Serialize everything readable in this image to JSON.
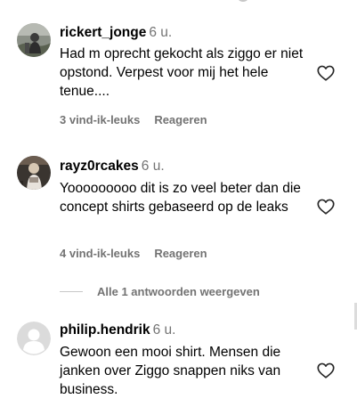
{
  "comments": [
    {
      "username": "rickert_jonge",
      "time": "6 u.",
      "text": "Had m oprecht gekocht als ziggo er niet opstond. Verpest voor mij het hele tenue....",
      "likes": "3 vind-ik-leuks",
      "reply_label": "Reageren",
      "like_icon": "heart-outline-icon"
    },
    {
      "username": "rayz0rcakes",
      "time": "6 u.",
      "text": "Yooooooooo dit is zo veel beter dan die concept shirts gebaseerd op de leaks",
      "likes": "4 vind-ik-leuks",
      "reply_label": "Reageren",
      "like_icon": "heart-outline-icon"
    },
    {
      "username": "philip.hendrik",
      "time": "6 u.",
      "text": "Gewoon een mooi shirt. Mensen die janken over Ziggo snappen niks van business.",
      "like_icon": "heart-outline-icon"
    }
  ],
  "view_replies": "Alle 1 antwoorden weergeven",
  "colors": {
    "secondary_text": "#737373",
    "icon_stroke": "#262626",
    "default_avatar_bg": "#dbdbdb",
    "default_avatar_fg": "#ffffff"
  }
}
